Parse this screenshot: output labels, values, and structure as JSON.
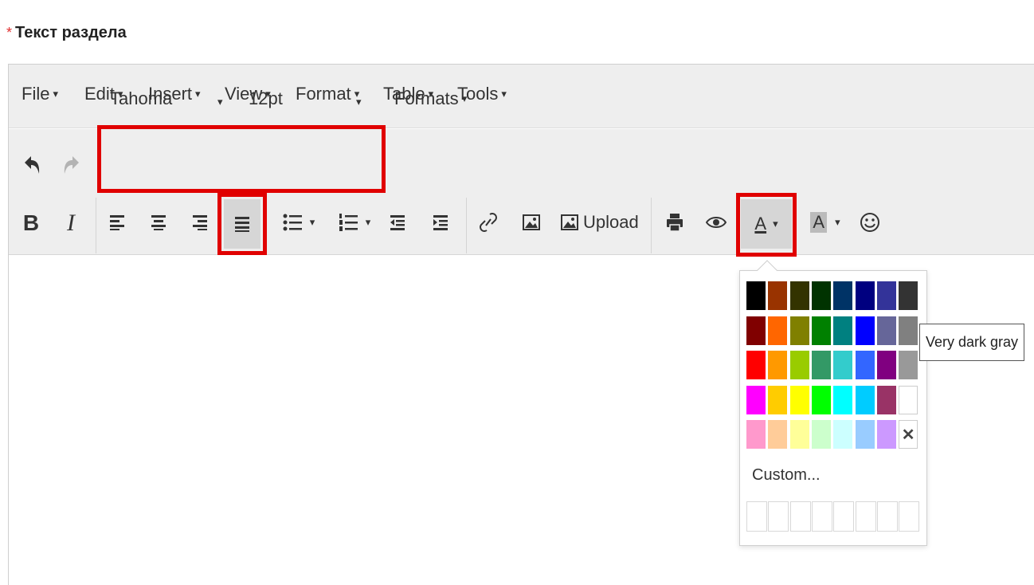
{
  "field": {
    "required_mark": "*",
    "label": "Текст раздела"
  },
  "menubar": [
    {
      "label": "File"
    },
    {
      "label": "Edit"
    },
    {
      "label": "Insert"
    },
    {
      "label": "View"
    },
    {
      "label": "Format"
    },
    {
      "label": "Table"
    },
    {
      "label": "Tools"
    }
  ],
  "toolbar": {
    "font_family": "Tahoma",
    "font_size": "12pt",
    "formats_label": "Formats",
    "upload_label": "Upload",
    "text_color_glyph": "A",
    "bg_color_glyph": "A",
    "bold_glyph": "B",
    "italic_glyph": "I",
    "caret": "▾",
    "icons": [
      "undo-icon",
      "redo-icon",
      "bold-icon",
      "italic-icon",
      "align-left-icon",
      "align-center-icon",
      "align-right-icon",
      "align-justify-icon",
      "bullet-list-icon",
      "numbered-list-icon",
      "outdent-icon",
      "indent-icon",
      "link-icon",
      "image-icon",
      "upload-image-icon",
      "print-icon",
      "preview-eye-icon",
      "text-color-icon",
      "background-color-icon",
      "emoticon-icon"
    ]
  },
  "color_picker": {
    "colors": [
      [
        "#000000",
        "#993300",
        "#333300",
        "#003300",
        "#003366",
        "#000080",
        "#333399",
        "#333333"
      ],
      [
        "#800000",
        "#FF6600",
        "#808000",
        "#008000",
        "#008080",
        "#0000FF",
        "#666699",
        "#808080"
      ],
      [
        "#FF0000",
        "#FF9900",
        "#99CC00",
        "#339966",
        "#33CCCC",
        "#3366FF",
        "#800080",
        "#999999"
      ],
      [
        "#FF00FF",
        "#FFCC00",
        "#FFFF00",
        "#00FF00",
        "#00FFFF",
        "#00CCFF",
        "#993366",
        "#FFFFFF"
      ],
      [
        "#FF99CC",
        "#FFCC99",
        "#FFFF99",
        "#CCFFCC",
        "#CCFFFF",
        "#99CCFF",
        "#CC99FF",
        "remove"
      ]
    ],
    "remove_glyph": "✕",
    "custom_label": "Custom...",
    "custom_slots": 8,
    "tooltip": "Very dark gray"
  },
  "accent_colors": {
    "highlight": "#e00000",
    "toolbar_bg": "#eeeeee"
  }
}
